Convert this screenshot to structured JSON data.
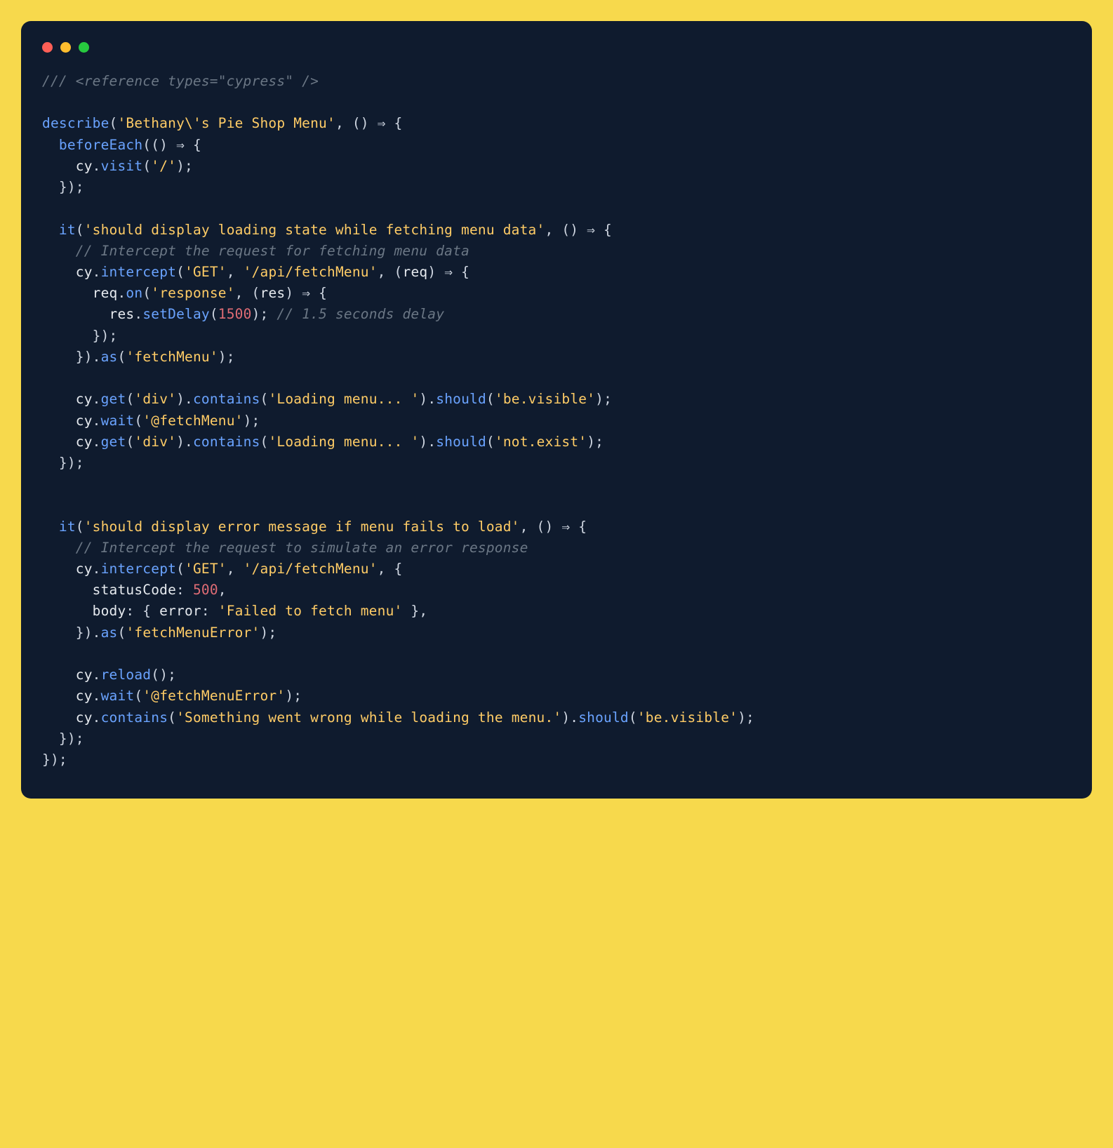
{
  "window": {
    "dots": [
      "red",
      "yellow",
      "green"
    ]
  },
  "code": {
    "l1_comment": "/// <reference types=\"cypress\" />",
    "describe": "describe",
    "beforeEach": "beforeEach",
    "cy": "cy",
    "visit": "visit",
    "it": "it",
    "intercept": "intercept",
    "on": "on",
    "setDelay": "setDelay",
    "as": "as",
    "get": "get",
    "contains": "contains",
    "should": "should",
    "wait": "wait",
    "reload": "reload",
    "req": "req",
    "res": "res",
    "test_suite_name": "'Bethany\\'s Pie Shop Menu'",
    "visit_path": "'/'",
    "test1_name": "'should display loading state while fetching menu data'",
    "test1_comment": "// Intercept the request for fetching menu data",
    "http_get": "'GET'",
    "api_path": "'/api/fetchMenu'",
    "response_event": "'response'",
    "delay_value": "1500",
    "delay_comment": "// 1.5 seconds delay",
    "alias_fetchMenu": "'fetchMenu'",
    "selector_div": "'div'",
    "loading_text": "'Loading menu... '",
    "assert_visible": "'be.visible'",
    "wait_fetchMenu": "'@fetchMenu'",
    "assert_notexist": "'not.exist'",
    "test2_name": "'should display error message if menu fails to load'",
    "test2_comment": "// Intercept the request to simulate an error response",
    "statusCode_key": "statusCode",
    "statusCode_val": "500",
    "body_key": "body",
    "error_key": "error",
    "error_val": "'Failed to fetch menu'",
    "alias_fetchMenuError": "'fetchMenuError'",
    "wait_fetchMenuError": "'@fetchMenuError'",
    "error_message": "'Something went wrong while loading the menu.'"
  }
}
